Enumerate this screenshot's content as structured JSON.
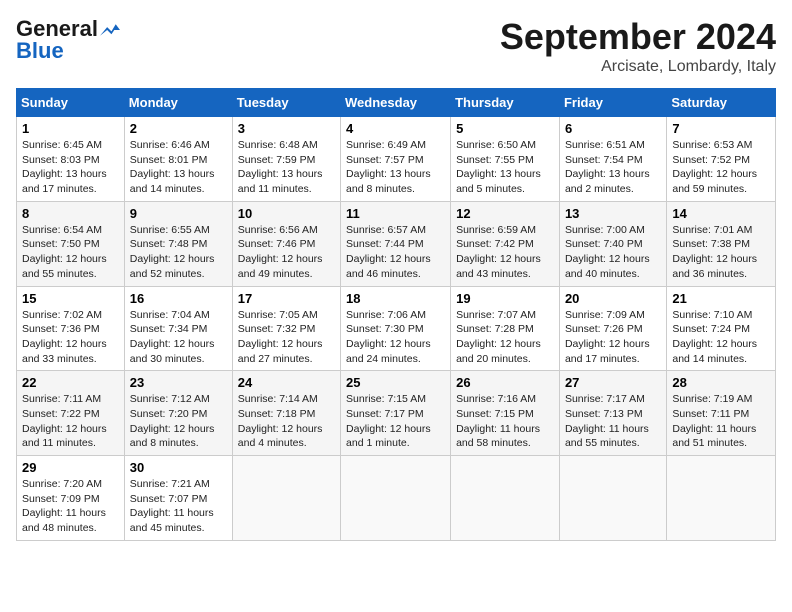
{
  "header": {
    "logo_general": "General",
    "logo_blue": "Blue",
    "month_title": "September 2024",
    "location": "Arcisate, Lombardy, Italy"
  },
  "weekdays": [
    "Sunday",
    "Monday",
    "Tuesday",
    "Wednesday",
    "Thursday",
    "Friday",
    "Saturday"
  ],
  "weeks": [
    [
      {
        "day": "1",
        "lines": [
          "Sunrise: 6:45 AM",
          "Sunset: 8:03 PM",
          "Daylight: 13 hours",
          "and 17 minutes."
        ]
      },
      {
        "day": "2",
        "lines": [
          "Sunrise: 6:46 AM",
          "Sunset: 8:01 PM",
          "Daylight: 13 hours",
          "and 14 minutes."
        ]
      },
      {
        "day": "3",
        "lines": [
          "Sunrise: 6:48 AM",
          "Sunset: 7:59 PM",
          "Daylight: 13 hours",
          "and 11 minutes."
        ]
      },
      {
        "day": "4",
        "lines": [
          "Sunrise: 6:49 AM",
          "Sunset: 7:57 PM",
          "Daylight: 13 hours",
          "and 8 minutes."
        ]
      },
      {
        "day": "5",
        "lines": [
          "Sunrise: 6:50 AM",
          "Sunset: 7:55 PM",
          "Daylight: 13 hours",
          "and 5 minutes."
        ]
      },
      {
        "day": "6",
        "lines": [
          "Sunrise: 6:51 AM",
          "Sunset: 7:54 PM",
          "Daylight: 13 hours",
          "and 2 minutes."
        ]
      },
      {
        "day": "7",
        "lines": [
          "Sunrise: 6:53 AM",
          "Sunset: 7:52 PM",
          "Daylight: 12 hours",
          "and 59 minutes."
        ]
      }
    ],
    [
      {
        "day": "8",
        "lines": [
          "Sunrise: 6:54 AM",
          "Sunset: 7:50 PM",
          "Daylight: 12 hours",
          "and 55 minutes."
        ]
      },
      {
        "day": "9",
        "lines": [
          "Sunrise: 6:55 AM",
          "Sunset: 7:48 PM",
          "Daylight: 12 hours",
          "and 52 minutes."
        ]
      },
      {
        "day": "10",
        "lines": [
          "Sunrise: 6:56 AM",
          "Sunset: 7:46 PM",
          "Daylight: 12 hours",
          "and 49 minutes."
        ]
      },
      {
        "day": "11",
        "lines": [
          "Sunrise: 6:57 AM",
          "Sunset: 7:44 PM",
          "Daylight: 12 hours",
          "and 46 minutes."
        ]
      },
      {
        "day": "12",
        "lines": [
          "Sunrise: 6:59 AM",
          "Sunset: 7:42 PM",
          "Daylight: 12 hours",
          "and 43 minutes."
        ]
      },
      {
        "day": "13",
        "lines": [
          "Sunrise: 7:00 AM",
          "Sunset: 7:40 PM",
          "Daylight: 12 hours",
          "and 40 minutes."
        ]
      },
      {
        "day": "14",
        "lines": [
          "Sunrise: 7:01 AM",
          "Sunset: 7:38 PM",
          "Daylight: 12 hours",
          "and 36 minutes."
        ]
      }
    ],
    [
      {
        "day": "15",
        "lines": [
          "Sunrise: 7:02 AM",
          "Sunset: 7:36 PM",
          "Daylight: 12 hours",
          "and 33 minutes."
        ]
      },
      {
        "day": "16",
        "lines": [
          "Sunrise: 7:04 AM",
          "Sunset: 7:34 PM",
          "Daylight: 12 hours",
          "and 30 minutes."
        ]
      },
      {
        "day": "17",
        "lines": [
          "Sunrise: 7:05 AM",
          "Sunset: 7:32 PM",
          "Daylight: 12 hours",
          "and 27 minutes."
        ]
      },
      {
        "day": "18",
        "lines": [
          "Sunrise: 7:06 AM",
          "Sunset: 7:30 PM",
          "Daylight: 12 hours",
          "and 24 minutes."
        ]
      },
      {
        "day": "19",
        "lines": [
          "Sunrise: 7:07 AM",
          "Sunset: 7:28 PM",
          "Daylight: 12 hours",
          "and 20 minutes."
        ]
      },
      {
        "day": "20",
        "lines": [
          "Sunrise: 7:09 AM",
          "Sunset: 7:26 PM",
          "Daylight: 12 hours",
          "and 17 minutes."
        ]
      },
      {
        "day": "21",
        "lines": [
          "Sunrise: 7:10 AM",
          "Sunset: 7:24 PM",
          "Daylight: 12 hours",
          "and 14 minutes."
        ]
      }
    ],
    [
      {
        "day": "22",
        "lines": [
          "Sunrise: 7:11 AM",
          "Sunset: 7:22 PM",
          "Daylight: 12 hours",
          "and 11 minutes."
        ]
      },
      {
        "day": "23",
        "lines": [
          "Sunrise: 7:12 AM",
          "Sunset: 7:20 PM",
          "Daylight: 12 hours",
          "and 8 minutes."
        ]
      },
      {
        "day": "24",
        "lines": [
          "Sunrise: 7:14 AM",
          "Sunset: 7:18 PM",
          "Daylight: 12 hours",
          "and 4 minutes."
        ]
      },
      {
        "day": "25",
        "lines": [
          "Sunrise: 7:15 AM",
          "Sunset: 7:17 PM",
          "Daylight: 12 hours",
          "and 1 minute."
        ]
      },
      {
        "day": "26",
        "lines": [
          "Sunrise: 7:16 AM",
          "Sunset: 7:15 PM",
          "Daylight: 11 hours",
          "and 58 minutes."
        ]
      },
      {
        "day": "27",
        "lines": [
          "Sunrise: 7:17 AM",
          "Sunset: 7:13 PM",
          "Daylight: 11 hours",
          "and 55 minutes."
        ]
      },
      {
        "day": "28",
        "lines": [
          "Sunrise: 7:19 AM",
          "Sunset: 7:11 PM",
          "Daylight: 11 hours",
          "and 51 minutes."
        ]
      }
    ],
    [
      {
        "day": "29",
        "lines": [
          "Sunrise: 7:20 AM",
          "Sunset: 7:09 PM",
          "Daylight: 11 hours",
          "and 48 minutes."
        ]
      },
      {
        "day": "30",
        "lines": [
          "Sunrise: 7:21 AM",
          "Sunset: 7:07 PM",
          "Daylight: 11 hours",
          "and 45 minutes."
        ]
      },
      {
        "day": "",
        "lines": []
      },
      {
        "day": "",
        "lines": []
      },
      {
        "day": "",
        "lines": []
      },
      {
        "day": "",
        "lines": []
      },
      {
        "day": "",
        "lines": []
      }
    ]
  ]
}
